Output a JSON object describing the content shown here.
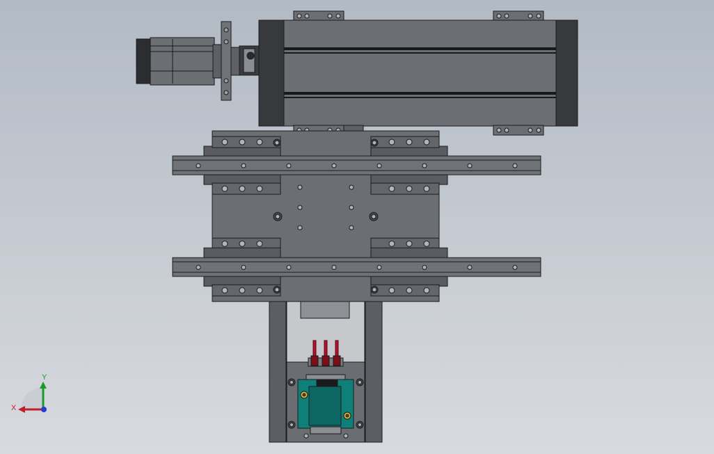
{
  "viewport": {
    "background_top": "#b2bac4",
    "background_bottom": "#d8dadf"
  },
  "model": {
    "body_color": "#6b6e73",
    "body_dark": "#3c3e42",
    "edge_color": "#1c1c1e",
    "sensor_color": "#b3122a",
    "component_color": "#0f7f7a",
    "component_accent": "#d6b43a"
  },
  "triad": {
    "x_label": "X",
    "y_label": "Y",
    "x_color": "#c0202a",
    "y_color": "#1a9a2a",
    "z_color": "#2a3ad0"
  }
}
